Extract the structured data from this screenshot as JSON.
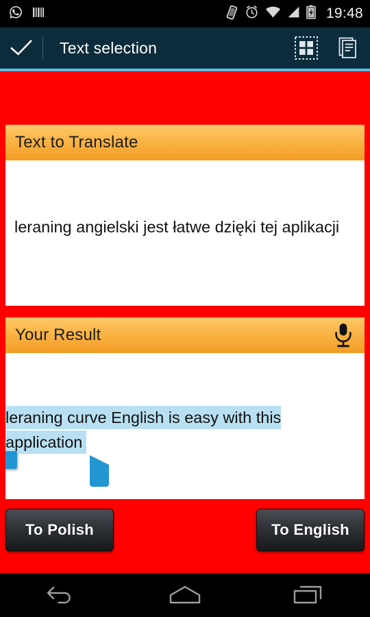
{
  "statusbar": {
    "icons_left": [
      "whatsapp-icon",
      "barcode-icon"
    ],
    "icons_right": [
      "vibrate-icon",
      "alarm-icon",
      "wifi-icon",
      "signal-icon",
      "battery-charging-icon"
    ],
    "time": "19:48"
  },
  "actionbar": {
    "confirm_label": "check-icon",
    "title": "Text selection",
    "actions": [
      {
        "name": "select-all-icon"
      },
      {
        "name": "copy-icon"
      }
    ],
    "bg_color": "#0c2c3c",
    "accent_color": "#5bb9e0"
  },
  "theme": {
    "background": "#ff0000",
    "card_header_orange": "#f5a623",
    "selection_highlight": "#b9e0f2",
    "handle_blue": "#2196d3"
  },
  "cards": {
    "input": {
      "title": "Text to Translate",
      "text": "leraning angielski jest łatwe dzięki tej aplikacji"
    },
    "result": {
      "title": "Your Result",
      "mic_icon": "microphone-icon",
      "text_line1": "leraning curve English is easy with this",
      "text_line2": "application",
      "selected_text": "leraning curve English is easy with this application"
    }
  },
  "buttons": {
    "to_polish": "To Polish",
    "to_english": "To English"
  },
  "navbar": {
    "back": "back-icon",
    "home": "home-icon",
    "recents": "recents-icon"
  }
}
